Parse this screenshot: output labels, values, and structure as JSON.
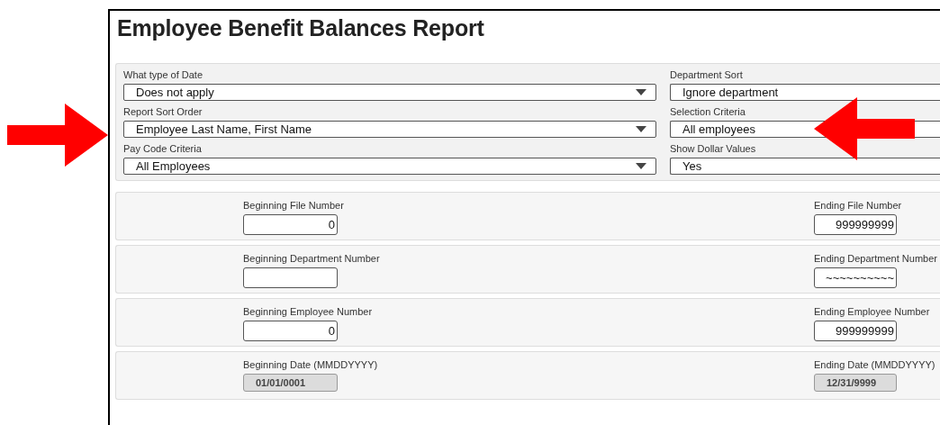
{
  "title": "Employee Benefit Balances Report",
  "left_fields": [
    {
      "label": "What type of Date",
      "value": "Does not apply"
    },
    {
      "label": "Report Sort Order",
      "value": "Employee Last Name, First Name"
    },
    {
      "label": "Pay Code Criteria",
      "value": "All Employees"
    }
  ],
  "right_fields": [
    {
      "label": "Department Sort",
      "value": "Ignore department"
    },
    {
      "label": "Selection Criteria",
      "value": "All employees"
    },
    {
      "label": "Show Dollar Values",
      "value": "Yes"
    }
  ],
  "ranges": [
    {
      "begin": {
        "label": "Beginning File Number",
        "value": "0",
        "disabled": false
      },
      "end": {
        "label": "Ending File Number",
        "value": "999999999",
        "disabled": false
      }
    },
    {
      "begin": {
        "label": "Beginning Department Number",
        "disabled": false
      },
      "end": {
        "label": "Ending Department Number",
        "value": "~~~~~~~~~~",
        "disabled": false
      }
    },
    {
      "begin": {
        "label": "Beginning Employee Number",
        "value": "0",
        "disabled": false
      },
      "end": {
        "label": "Ending Employee Number",
        "value": "999999999",
        "disabled": false
      }
    },
    {
      "begin": {
        "label": "Beginning Date (MMDDYYYY)",
        "value": "01/01/0001",
        "disabled": true
      },
      "end": {
        "label": "Ending Date (MMDDYYYY)",
        "value": "12/31/9999",
        "disabled": true
      }
    }
  ],
  "annotations": [
    {
      "kind": "right_arrow"
    },
    {
      "kind": "left_arrow"
    }
  ]
}
